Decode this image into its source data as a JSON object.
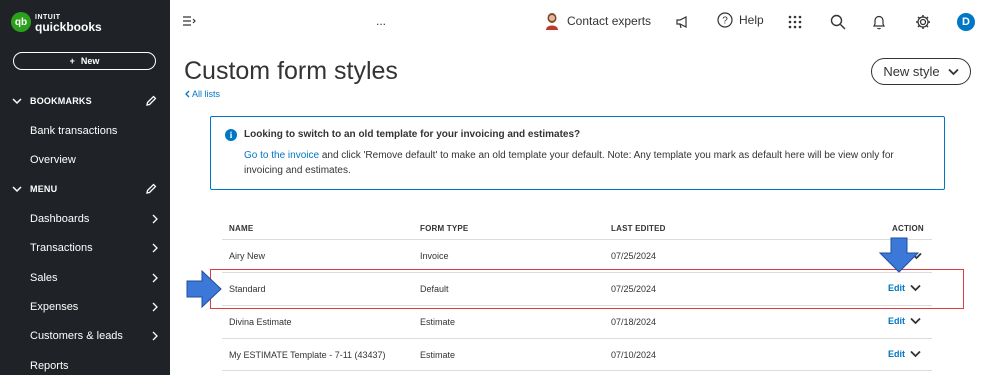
{
  "app": {
    "logo_top": "INTUIT",
    "logo_bottom": "quickbooks",
    "new_button": "New"
  },
  "sidebar": {
    "bookmarks_label": "BOOKMARKS",
    "bookmarks": [
      "Bank transactions",
      "Overview"
    ],
    "menu_label": "MENU",
    "menu_items": [
      "Dashboards",
      "Transactions",
      "Sales",
      "Expenses",
      "Customers & leads",
      "Reports"
    ]
  },
  "topbar": {
    "ellipsis": "...",
    "contact_experts": "Contact experts",
    "help": "Help",
    "user_initial": "D"
  },
  "page": {
    "title": "Custom form styles",
    "back_link": "All lists",
    "new_style_button": "New style"
  },
  "info": {
    "title": "Looking to switch to an old template for your invoicing and estimates?",
    "link": "Go to the invoice",
    "body": " and click 'Remove default' to make an old template your default. Note: Any template you mark as default here will be view only for invoicing and estimates."
  },
  "table": {
    "headers": {
      "name": "NAME",
      "form_type": "FORM TYPE",
      "last_edited": "LAST EDITED",
      "action": "ACTION"
    },
    "rows": [
      {
        "name": "Airy New",
        "form_type": "Invoice",
        "last_edited": "07/25/2024",
        "action": "Edit"
      },
      {
        "name": "Standard",
        "form_type": "Default",
        "last_edited": "07/25/2024",
        "action": "Edit"
      },
      {
        "name": "Divina Estimate",
        "form_type": "Estimate",
        "last_edited": "07/18/2024",
        "action": "Edit"
      },
      {
        "name": "My ESTIMATE Template - 7-11 (43437)",
        "form_type": "Estimate",
        "last_edited": "07/10/2024",
        "action": "Edit"
      }
    ]
  },
  "colors": {
    "sidebar_bg": "#1f2328",
    "link_blue": "#0077c5",
    "highlight_red": "#e23b3b",
    "arrow_blue": "#3b78d8",
    "brand_green": "#2ca01c"
  }
}
